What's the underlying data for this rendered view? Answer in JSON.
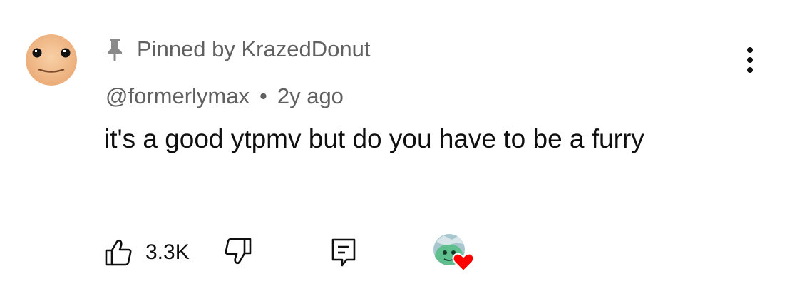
{
  "comment": {
    "pinned_label": "Pinned by KrazedDonut",
    "author": "@formerlymax",
    "separator": "•",
    "time": "2y ago",
    "text": "it's a good ytpmv but do you have to be a furry"
  },
  "actions": {
    "like_count": "3.3K"
  },
  "icons": {
    "pin": "pin-icon",
    "like": "thumbs-up-icon",
    "dislike": "thumbs-down-icon",
    "reply": "reply-icon",
    "menu": "more-vertical-icon",
    "heart": "creator-heart-icon"
  },
  "colors": {
    "text": "#0f0f0f",
    "secondary": "#606060",
    "heart": "#ff0000",
    "avatar_bg": "#f4c08f"
  }
}
